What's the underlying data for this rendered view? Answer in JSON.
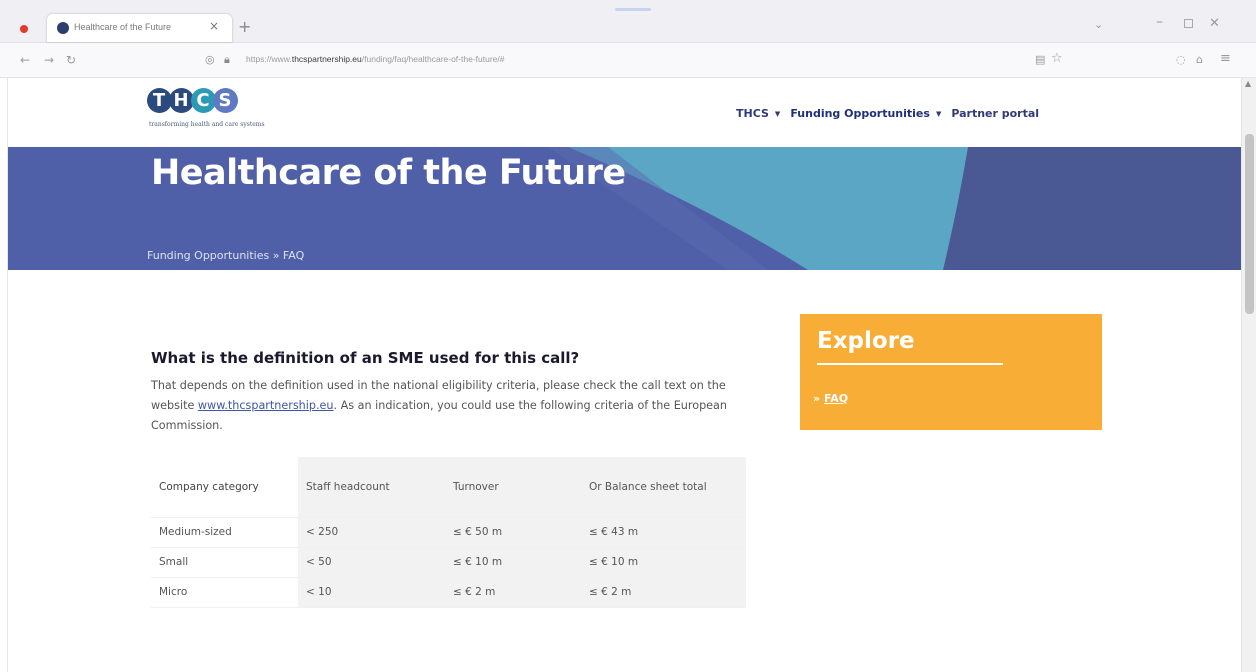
{
  "browser": {
    "tab_title": "Healthcare of the Future",
    "url_prefix": "https://www.",
    "url_domain": "thcspartnership.eu",
    "url_path": "/funding/faq/healthcare-of-the-future/#",
    "new_tab_symbol": "+",
    "close_symbol": "×"
  },
  "site": {
    "logo_text": "THCS",
    "logo_tagline": "transforming health and care systems",
    "nav": [
      {
        "label": "THCS"
      },
      {
        "label": "Funding Opportunities"
      },
      {
        "label": "Partner portal"
      }
    ]
  },
  "hero": {
    "title": "Healthcare of the Future",
    "breadcrumb": "Funding Opportunities » FAQ"
  },
  "colors": {
    "hero_base": "#5060a8",
    "hero_teal": "#5aa6c4",
    "hero_dark": "#4a5893",
    "explore_bg": "#f8ad36",
    "link": "#3e56a8"
  },
  "article": {
    "question": "What is the definition of an SME used for this call?",
    "body_before_link": "That depends on the definition used in the national eligibility criteria, please check the call text on the website ",
    "link_text": "www.thcspartnership.eu",
    "body_after_link": ". As an indication, you could use the following criteria of the European Commission."
  },
  "table": {
    "headers": [
      "Company category",
      "Staff headcount",
      "Turnover",
      "Or Balance sheet total"
    ],
    "rows": [
      [
        "Medium-sized",
        "< 250",
        "≤ € 50 m",
        "≤ € 43 m"
      ],
      [
        "Small",
        "< 50",
        "≤ € 10 m",
        "≤ € 10 m"
      ],
      [
        "Micro",
        "< 10",
        "≤ € 2 m",
        "≤ € 2 m"
      ]
    ]
  },
  "explore": {
    "title": "Explore",
    "link_prefix": "» ",
    "link_label": "FAQ"
  }
}
